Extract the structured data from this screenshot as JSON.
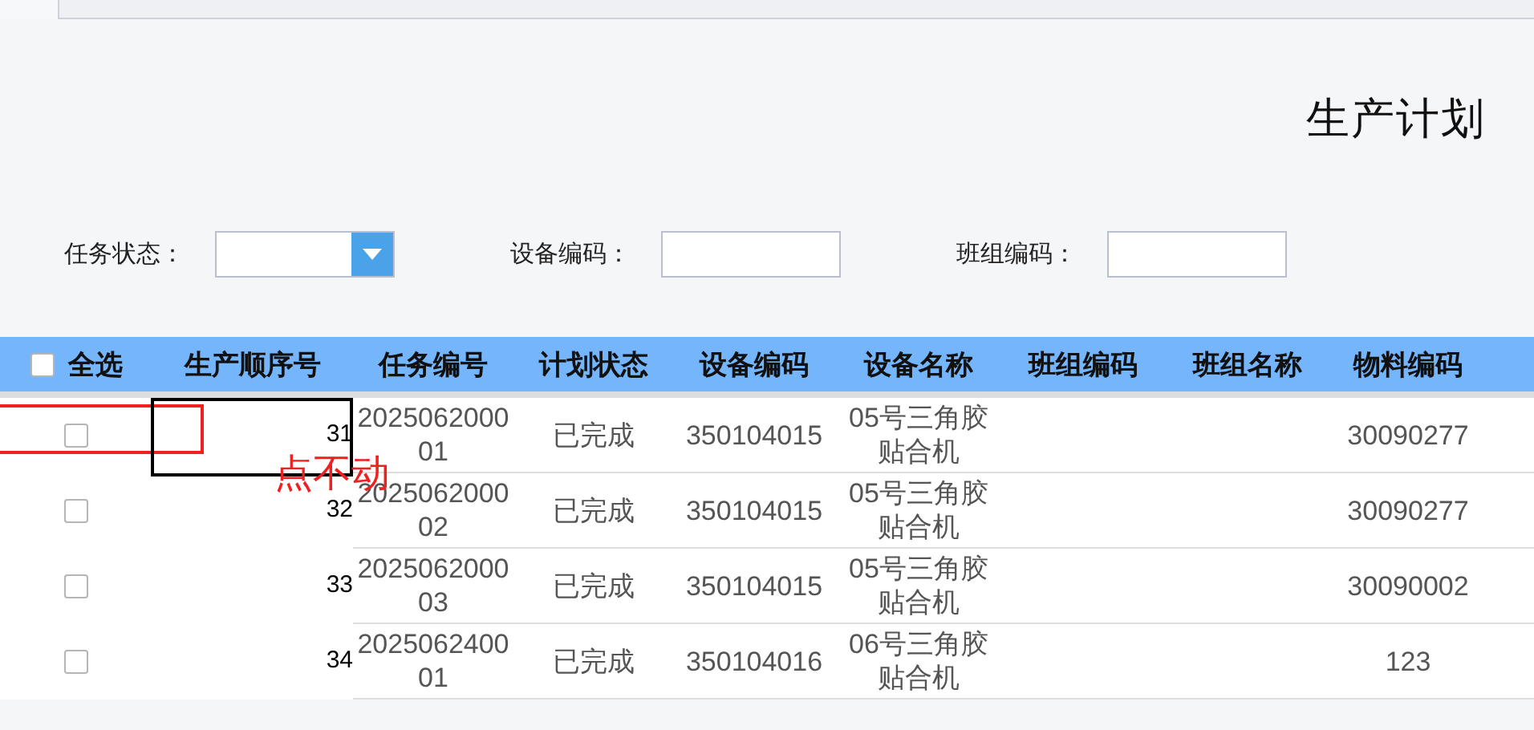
{
  "title": "生产计划",
  "filters": [
    {
      "label": "任务状态：",
      "kind": "select"
    },
    {
      "label": "设备编码：",
      "kind": "text"
    },
    {
      "label": "班组编码：",
      "kind": "text"
    }
  ],
  "table": {
    "select_all": {
      "label": "全选",
      "checked": false
    },
    "columns": [
      "生产顺序号",
      "任务编号",
      "计划状态",
      "设备编码",
      "设备名称",
      "班组编码",
      "班组名称",
      "物料编码"
    ],
    "rows": [
      {
        "checked": false,
        "sequence": "31",
        "task_no": "202506200001",
        "plan_status": "已完成",
        "equipment_code": "350104015",
        "equipment_name": "05号三角胶贴合机",
        "material_code": "30090277"
      },
      {
        "checked": false,
        "sequence": "32",
        "task_no": "202506200002",
        "plan_status": "已完成",
        "equipment_code": "350104015",
        "equipment_name": "05号三角胶贴合机",
        "material_code": "30090277"
      },
      {
        "checked": false,
        "sequence": "33",
        "task_no": "202506200003",
        "plan_status": "已完成",
        "equipment_code": "350104015",
        "equipment_name": "05号三角胶贴合机",
        "material_code": "30090002"
      },
      {
        "checked": false,
        "sequence": "34",
        "task_no": "202506240001",
        "plan_status": "已完成",
        "equipment_code": "350104016",
        "equipment_name": "06号三角胶贴合机",
        "material_code": "123"
      }
    ]
  },
  "annotation": {
    "text": "点不动"
  }
}
